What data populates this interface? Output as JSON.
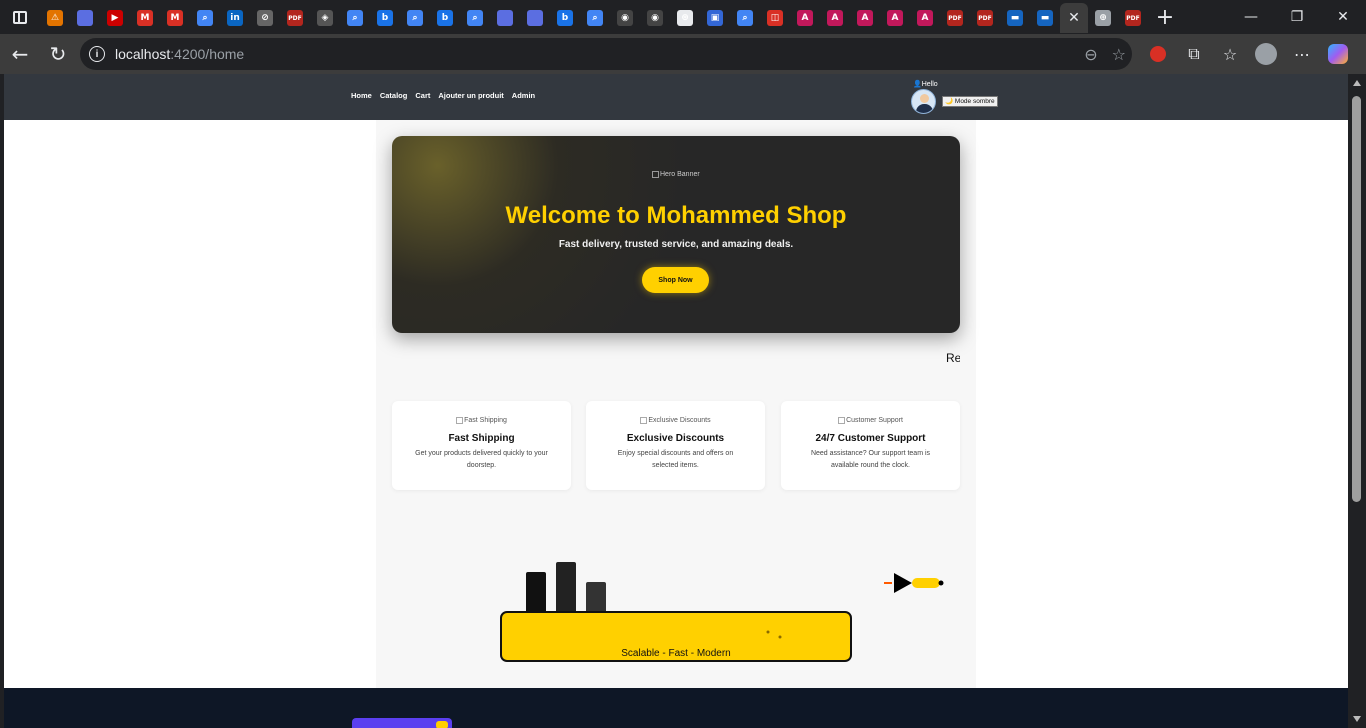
{
  "browser": {
    "url_host": "localhost",
    "url_path": ":4200/home",
    "tab_favicons": [
      {
        "name": "tab-1",
        "glyph": "⚠",
        "color": "#e37400"
      },
      {
        "name": "tab-2",
        "glyph": "",
        "color": "#5b6ee1"
      },
      {
        "name": "tab-3",
        "glyph": "▶",
        "color": "#cc0000"
      },
      {
        "name": "tab-4",
        "glyph": "M",
        "color": "#d93025"
      },
      {
        "name": "tab-5",
        "glyph": "M",
        "color": "#d93025"
      },
      {
        "name": "tab-6",
        "glyph": "⌕",
        "color": "#4285f4"
      },
      {
        "name": "tab-7",
        "glyph": "in",
        "color": "#0a66c2"
      },
      {
        "name": "tab-8",
        "glyph": "⊘",
        "color": "#666666"
      },
      {
        "name": "tab-9",
        "glyph": "PDF",
        "color": "#b3261e"
      },
      {
        "name": "tab-10",
        "glyph": "◈",
        "color": "#555555"
      },
      {
        "name": "tab-11",
        "glyph": "⌕",
        "color": "#4285f4"
      },
      {
        "name": "tab-12",
        "glyph": "b",
        "color": "#1a73e8"
      },
      {
        "name": "tab-13",
        "glyph": "⌕",
        "color": "#4285f4"
      },
      {
        "name": "tab-14",
        "glyph": "b",
        "color": "#1a73e8"
      },
      {
        "name": "tab-15",
        "glyph": "⌕",
        "color": "#4285f4"
      },
      {
        "name": "tab-16",
        "glyph": "",
        "color": "#5b6ee1"
      },
      {
        "name": "tab-17",
        "glyph": "",
        "color": "#5b6ee1"
      },
      {
        "name": "tab-18",
        "glyph": "b",
        "color": "#1a73e8"
      },
      {
        "name": "tab-19",
        "glyph": "⌕",
        "color": "#4285f4"
      },
      {
        "name": "tab-20",
        "glyph": "◉",
        "color": "#444444"
      },
      {
        "name": "tab-21",
        "glyph": "◉",
        "color": "#444444"
      },
      {
        "name": "tab-22",
        "glyph": "⊛",
        "color": "#e8eaed"
      },
      {
        "name": "tab-23",
        "glyph": "▣",
        "color": "#3367d6"
      },
      {
        "name": "tab-24",
        "glyph": "⌕",
        "color": "#4285f4"
      },
      {
        "name": "tab-25",
        "glyph": "◫",
        "color": "#d93025"
      },
      {
        "name": "tab-26",
        "glyph": "A",
        "color": "#c2185b"
      },
      {
        "name": "tab-27",
        "glyph": "A",
        "color": "#c2185b"
      },
      {
        "name": "tab-28",
        "glyph": "A",
        "color": "#c2185b"
      },
      {
        "name": "tab-29",
        "glyph": "A",
        "color": "#c2185b"
      },
      {
        "name": "tab-30",
        "glyph": "A",
        "color": "#c2185b"
      },
      {
        "name": "tab-31",
        "glyph": "PDF",
        "color": "#b3261e"
      },
      {
        "name": "tab-32",
        "glyph": "PDF",
        "color": "#b3261e"
      },
      {
        "name": "tab-33",
        "glyph": "▬",
        "color": "#1565c0"
      },
      {
        "name": "tab-34",
        "glyph": "▬",
        "color": "#1565c0"
      }
    ],
    "active_tab_close": "✕",
    "after_tabs": [
      {
        "name": "tab-35",
        "glyph": "⊕",
        "color": "#9aa0a6"
      },
      {
        "name": "tab-36",
        "glyph": "PDF",
        "color": "#b3261e"
      }
    ]
  },
  "site": {
    "nav_links": [
      "Home",
      "Catalog",
      "Cart",
      "Ajouter un produit",
      "Admin"
    ],
    "hello": "👤Hello",
    "mode_button": "🌙 Mode sombre",
    "hero": {
      "image_alt": "Hero Banner",
      "title": "Welcome to Mohammed Shop",
      "subtitle": "Fast delivery, trusted service, and amazing deals.",
      "button": "Shop Now"
    },
    "marquee": "Re",
    "features": [
      {
        "image_alt": "Fast Shipping",
        "title": "Fast Shipping",
        "text": "Get your products delivered quickly to your doorstep."
      },
      {
        "image_alt": "Exclusive Discounts",
        "title": "Exclusive Discounts",
        "text": "Enjoy special discounts and offers on selected items."
      },
      {
        "image_alt": "Customer Support",
        "title": "24/7 Customer Support",
        "text": "Need assistance? Our support team is available round the clock."
      }
    ],
    "illustration_text": "Scalable - Fast - Modern"
  },
  "colors": {
    "accent": "#ffd000",
    "nav_bg": "#33383f",
    "hero_bg": "#272727",
    "footer_bg": "#0e1726"
  }
}
